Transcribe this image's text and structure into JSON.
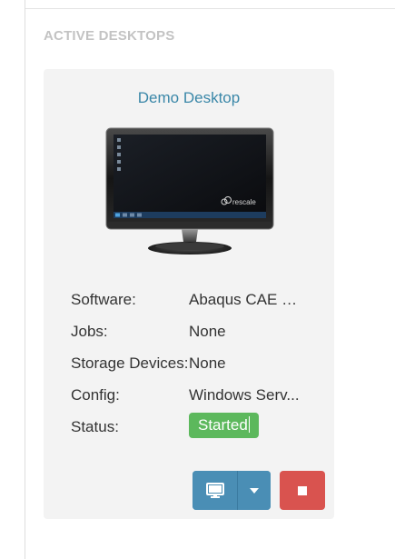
{
  "section": {
    "title": "ACTIVE DESKTOPS"
  },
  "card": {
    "title": "Demo Desktop",
    "monitor_brand": "rescale",
    "rows": [
      {
        "label": "Software:",
        "value": "Abaqus CAE GUI"
      },
      {
        "label": "Jobs:",
        "value": "None"
      },
      {
        "label": "Storage Devices:",
        "value": "None"
      },
      {
        "label": "Config:",
        "value": "Windows Serv..."
      },
      {
        "label": "Status:",
        "value": "Started"
      }
    ]
  },
  "buttons": {
    "connect_icon": "desktop-icon",
    "dropdown_icon": "caret-down-icon",
    "stop_icon": "stop-icon"
  },
  "colors": {
    "accent": "#3a87a8",
    "primary_button": "#4a8eb5",
    "stop_button": "#d9534f",
    "status_started": "#5cb85c"
  }
}
